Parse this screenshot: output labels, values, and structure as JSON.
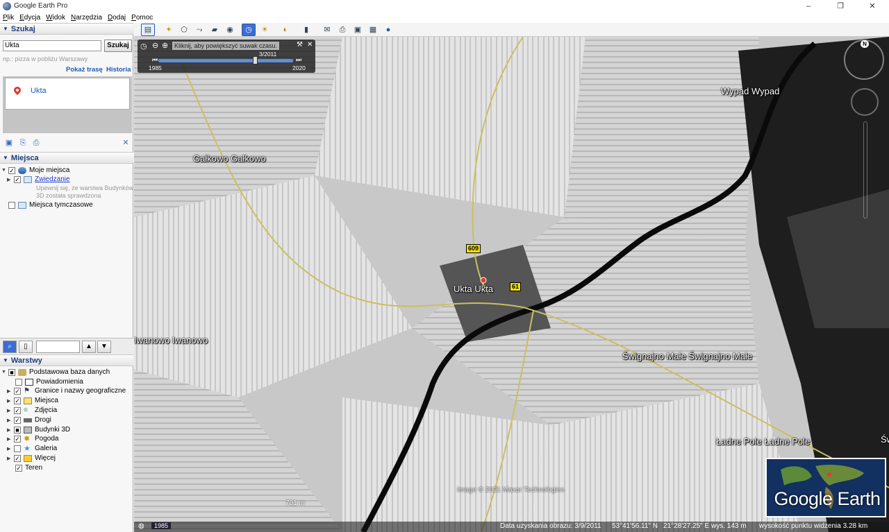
{
  "window": {
    "title": "Google Earth Pro",
    "minimize": "–",
    "maximize": "❐",
    "close": "✕"
  },
  "menu": [
    "Plik",
    "Edycja",
    "Widok",
    "Narzędzia",
    "Dodaj",
    "Pomoc"
  ],
  "search": {
    "header": "Szukaj",
    "value": "Ukta",
    "button": "Szukaj",
    "hint": "np.: pizza w pobliżu Warszawy",
    "show_route": "Pokaż trasę",
    "history": "Historia",
    "result": "Ukta"
  },
  "places": {
    "header": "Miejsca",
    "my_places": "Moje miejsca",
    "tour": "Zwiedzanie",
    "tour_note_1": "Upewnij się, że warstwa Budynków",
    "tour_note_2": "3D została sprawdzona",
    "temp_places": "Miejsca tymczasowe"
  },
  "layers": {
    "header": "Warstwy",
    "items": [
      {
        "label": "Podstawowa baza danych",
        "checked": "■",
        "icon": "database-icon"
      },
      {
        "label": "Powiadomienia",
        "checked": "",
        "icon": "mail-icon"
      },
      {
        "label": "Granice i nazwy geograficzne",
        "checked": "✓",
        "icon": "flag-icon"
      },
      {
        "label": "Miejsca",
        "checked": "✓",
        "icon": "places-icon"
      },
      {
        "label": "Zdjęcia",
        "checked": "✓",
        "icon": "photo-icon"
      },
      {
        "label": "Drogi",
        "checked": "✓",
        "icon": "road-icon"
      },
      {
        "label": "Budynki 3D",
        "checked": "■",
        "icon": "building-icon"
      },
      {
        "label": "Pogoda",
        "checked": "✓",
        "icon": "weather-icon"
      },
      {
        "label": "Galeria",
        "checked": "",
        "icon": "gallery-icon"
      },
      {
        "label": "Więcej",
        "checked": "✓",
        "icon": "more-icon"
      },
      {
        "label": "Teren",
        "checked": "✓",
        "icon": "terrain-icon"
      }
    ]
  },
  "timeslider": {
    "tooltip": "Kliknij, aby powiększyć suwak czasu.",
    "start": "1985",
    "end": "2020",
    "current": "3/2011"
  },
  "map": {
    "labels": [
      {
        "text": "Gałkowo  Gałkowo",
        "name": "label-galkowo"
      },
      {
        "text": "Ukta  Ukta",
        "name": "label-ukta"
      },
      {
        "text": "Wypad  Wypad",
        "name": "label-wypad"
      },
      {
        "text": "Iwanowo  Iwanowo",
        "name": "label-iwanowo"
      },
      {
        "text": "Śwignajno Małe  Śwignajno Małe",
        "name": "label-swignajno"
      },
      {
        "text": "Ładne Pole  Ładne Pole",
        "name": "label-ladne-pole"
      },
      {
        "text": "Św",
        "name": "label-sw"
      }
    ],
    "routes": [
      "609",
      "61"
    ],
    "attribution": "Image © 2021 Maxar Technologies",
    "scale": "701 m",
    "logo": "Google Earth",
    "compass_north": "N"
  },
  "status": {
    "year": "1985",
    "date": "Data uzyskania obrazu: 3/9/2011",
    "lat": "53°41'56.11\" N",
    "lon": "21°28'27.25\" E",
    "elev": "wys.  143 m",
    "eye": "wysokość punktu widzenia   3.28 km"
  }
}
